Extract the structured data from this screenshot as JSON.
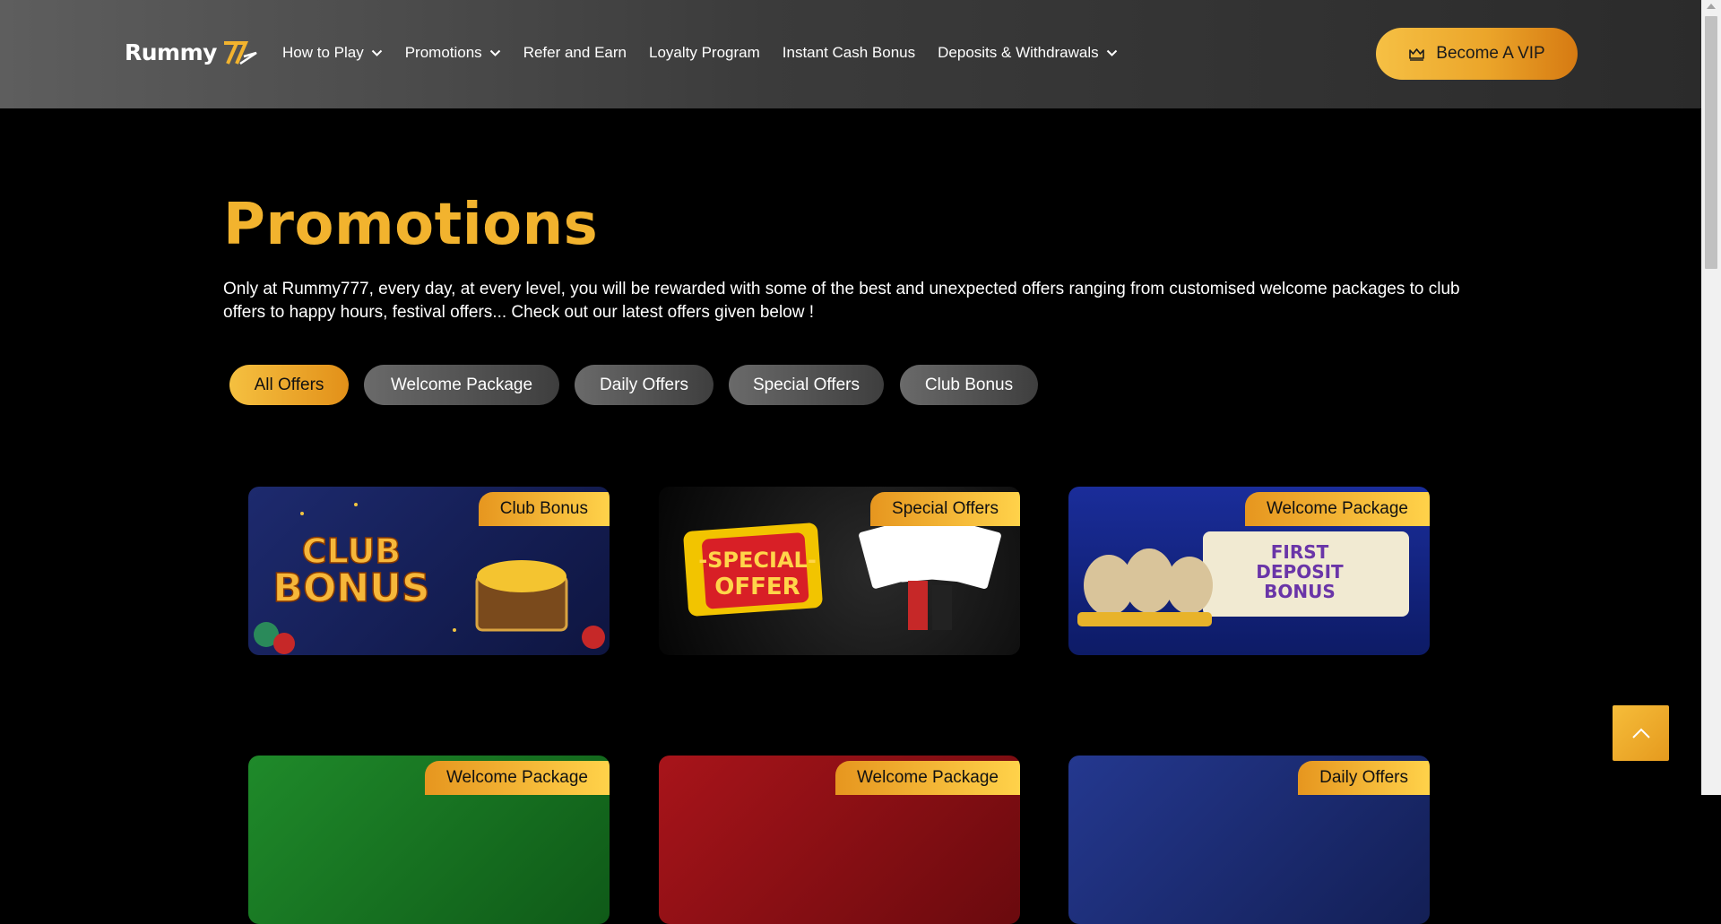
{
  "header": {
    "logo_text": "Rummy",
    "nav": [
      {
        "label": "How to Play",
        "dropdown": true
      },
      {
        "label": "Promotions",
        "dropdown": true
      },
      {
        "label": "Refer and Earn",
        "dropdown": false
      },
      {
        "label": "Loyalty Program",
        "dropdown": false
      },
      {
        "label": "Instant Cash Bonus",
        "dropdown": false
      },
      {
        "label": "Deposits & Withdrawals",
        "dropdown": true
      }
    ],
    "vip_label": "Become A VIP"
  },
  "main": {
    "title": "Promotions",
    "intro": "Only at Rummy777, every day, at every level, you will be rewarded with some of the best and unexpected offers ranging from customised welcome packages to club offers to happy hours, festival offers... Check out our latest offers given below !",
    "filters": [
      {
        "label": "All Offers",
        "active": true
      },
      {
        "label": "Welcome Package",
        "active": false
      },
      {
        "label": "Daily Offers",
        "active": false
      },
      {
        "label": "Special Offers",
        "active": false
      },
      {
        "label": "Club Bonus",
        "active": false
      }
    ],
    "cards": [
      {
        "badge": "Club Bonus",
        "art_text_1": "CLUB",
        "art_text_2": "BONUS"
      },
      {
        "badge": "Special Offers",
        "art_text_1": "-SPECIAL-",
        "art_text_2": "OFFER"
      },
      {
        "badge": "Welcome Package",
        "art_text_1": "FIRST",
        "art_text_2": "DEPOSIT",
        "art_text_3": "BONUS"
      },
      {
        "badge": "Welcome Package"
      },
      {
        "badge": "Welcome Package"
      },
      {
        "badge": "Daily Offers"
      }
    ]
  },
  "colors": {
    "accent": "#f2b32e",
    "header_bg": "#3b3b3b",
    "page_bg": "#000000"
  },
  "icons": [
    "chevron-down-icon",
    "crown-icon",
    "arrow-up-icon"
  ]
}
